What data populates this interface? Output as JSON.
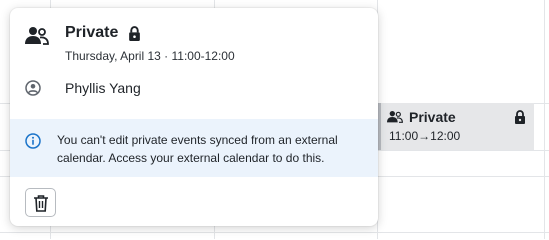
{
  "popover": {
    "title": "Private",
    "subtitle": "Thursday, April 13 · 11:00-12:00",
    "person_name": "Phyllis Yang",
    "info_message": "You can't edit private events synced from an external calendar. Access your external calendar to do this.",
    "icons": {
      "header": "people-icon",
      "title_badge": "lock-icon",
      "person": "user-circle-icon",
      "info": "info-circle-icon",
      "delete": "trash-icon"
    }
  },
  "event": {
    "title": "Private",
    "time": "11:00→12:00"
  },
  "colors": {
    "info_background": "#ebf3fc",
    "info_icon": "#1a73c9",
    "event_background": "#e6e7e9"
  }
}
